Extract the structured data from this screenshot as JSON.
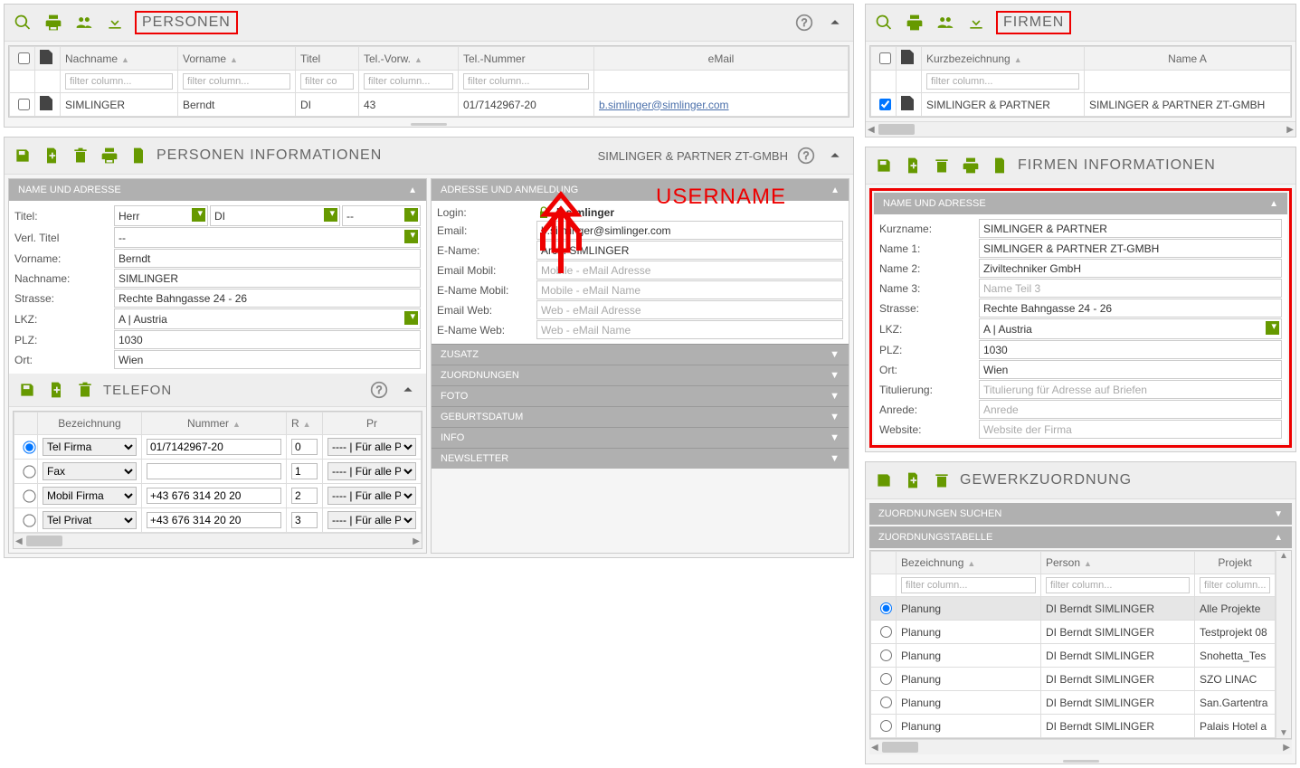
{
  "personen": {
    "title": "PERSONEN",
    "columns": [
      "Nachname",
      "Vorname",
      "Titel",
      "Tel.-Vorw.",
      "Tel.-Nummer",
      "eMail"
    ],
    "filter_placeholder": "filter column...",
    "row": {
      "nachname": "SIMLINGER",
      "vorname": "Berndt",
      "titel": "DI",
      "vorwahl": "43",
      "nummer": "01/7142967-20",
      "email": "b.simlinger@simlinger.com"
    }
  },
  "pinfo": {
    "title": "PERSONEN INFORMATIONEN",
    "context": "SIMLINGER & PARTNER ZT-GMBH",
    "sec_name": "NAME UND ADRESSE",
    "labels": {
      "titel": "Titel:",
      "verltitel": "Verl. Titel",
      "vorname": "Vorname:",
      "nachname": "Nachname:",
      "strasse": "Strasse:",
      "lkz": "LKZ:",
      "plz": "PLZ:",
      "ort": "Ort:"
    },
    "values": {
      "titel_sel1": "Herr",
      "titel_sel2": "DI",
      "titel_sel3": "--",
      "verl_sel": "--",
      "vorname": "Berndt",
      "nachname": "SIMLINGER",
      "strasse": "Rechte Bahngasse 24 - 26",
      "lkz": "A | Austria",
      "plz": "1030",
      "ort": "Wien"
    }
  },
  "addr": {
    "sec": "ADRESSE UND ANMELDUNG",
    "labels": {
      "login": "Login:",
      "email": "Email:",
      "ename": "E-Name:",
      "emailmobil": "Email Mobil:",
      "enamemobil": "E-Name Mobil:",
      "emailweb": "Email Web:",
      "enameweb": "E-Name Web:"
    },
    "values": {
      "login": "b.simlinger",
      "email": "b.simlinger@simlinger.com",
      "ename": "Arch. SIMLINGER"
    },
    "placeholders": {
      "emailmobil": "Mobile - eMail Adresse",
      "enamemobil": "Mobile - eMail Name",
      "emailweb": "Web - eMail Adresse",
      "enameweb": "Web - eMail Name"
    },
    "accordion": [
      "ZUSATZ",
      "ZUORDNUNGEN",
      "FOTO",
      "GEBURTSDATUM",
      "INFO",
      "NEWSLETTER"
    ]
  },
  "tel": {
    "title": "TELEFON",
    "cols": [
      "Bezeichnung",
      "Nummer",
      "R",
      "Pr"
    ],
    "drop_opt": "---- | Für alle Pro",
    "rows": [
      {
        "bez": "Tel Firma",
        "num": "01/7142967-20",
        "r": "0"
      },
      {
        "bez": "Fax",
        "num": "",
        "r": "1"
      },
      {
        "bez": "Mobil Firma",
        "num": "+43 676 314 20 20",
        "r": "2"
      },
      {
        "bez": "Tel Privat",
        "num": "+43 676 314 20 20",
        "r": "3"
      }
    ]
  },
  "firmen": {
    "title": "FIRMEN",
    "cols": [
      "Kurzbezeichnung",
      "Name A"
    ],
    "filter_placeholder": "filter column...",
    "row": {
      "kurz": "SIMLINGER & PARTNER",
      "name": "SIMLINGER & PARTNER ZT-GMBH"
    }
  },
  "finfo": {
    "title": "FIRMEN INFORMATIONEN",
    "sec": "NAME UND ADRESSE",
    "labels": {
      "kurz": "Kurzname:",
      "name1": "Name 1:",
      "name2": "Name 2:",
      "name3": "Name 3:",
      "strasse": "Strasse:",
      "lkz": "LKZ:",
      "plz": "PLZ:",
      "ort": "Ort:",
      "titul": "Titulierung:",
      "anrede": "Anrede:",
      "website": "Website:"
    },
    "values": {
      "kurz": "SIMLINGER & PARTNER",
      "name1": "SIMLINGER & PARTNER ZT-GMBH",
      "name2": "Ziviltechniker GmbH",
      "strasse": "Rechte Bahngasse 24 - 26",
      "lkz": "A | Austria",
      "plz": "1030",
      "ort": "Wien"
    },
    "placeholders": {
      "name3": "Name Teil 3",
      "titul": "Titulierung für Adresse auf Briefen",
      "anrede": "Anrede",
      "website": "Website der Firma"
    }
  },
  "gewerk": {
    "title": "GEWERKZUORDNUNG",
    "search": "ZUORDNUNGEN SUCHEN",
    "table": "ZUORDNUNGSTABELLE",
    "cols": [
      "Bezeichnung",
      "Person",
      "Projekt"
    ],
    "filter_placeholder": "filter column...",
    "rows": [
      {
        "b": "Planung",
        "p": "DI Berndt SIMLINGER",
        "pr": "Alle Projekte"
      },
      {
        "b": "Planung",
        "p": "DI Berndt SIMLINGER",
        "pr": "Testprojekt 08"
      },
      {
        "b": "Planung",
        "p": "DI Berndt SIMLINGER",
        "pr": "Snohetta_Tes"
      },
      {
        "b": "Planung",
        "p": "DI Berndt SIMLINGER",
        "pr": "SZO LINAC"
      },
      {
        "b": "Planung",
        "p": "DI Berndt SIMLINGER",
        "pr": "San.Gartentra"
      },
      {
        "b": "Planung",
        "p": "DI Berndt SIMLINGER",
        "pr": "Palais Hotel a"
      }
    ]
  },
  "anno": {
    "username": "USERNAME"
  }
}
